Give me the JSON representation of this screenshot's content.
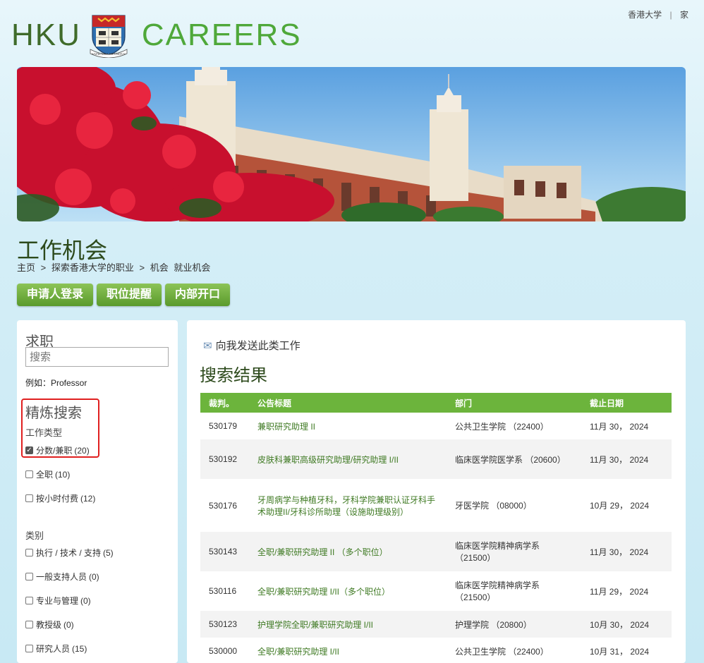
{
  "top_links": {
    "hku": "香港大学",
    "separator": "|",
    "home": "家"
  },
  "logo": {
    "left": "HKU",
    "right": "CAREERS",
    "crest_motto": "SAPIENTIA ET VIRTUS"
  },
  "page": {
    "title": "工作机会",
    "breadcrumb": [
      "主页",
      ">",
      "探索香港大学的职业",
      ">",
      "机会",
      "就业机会"
    ]
  },
  "tabs": [
    "申请人登录",
    "职位提醒",
    "内部开口"
  ],
  "sidebar": {
    "search_title": "求职",
    "search_placeholder": "搜索",
    "example": "例如：Professor",
    "refine_title": "精炼搜索",
    "job_type_title": "工作类型",
    "job_types": [
      {
        "label": "分数/兼职",
        "count": "(20)",
        "checked": true
      },
      {
        "label": "全职",
        "count": "(10)",
        "checked": false
      },
      {
        "label": "按小时付费",
        "count": "(12)",
        "checked": false
      }
    ],
    "category_title": "类别",
    "categories": [
      {
        "label": "执行 / 技术 / 支持",
        "count": "(5)",
        "checked": false
      },
      {
        "label": "一般支持人员",
        "count": "(0)",
        "checked": false
      },
      {
        "label": "专业与管理",
        "count": "(0)",
        "checked": false
      },
      {
        "label": "教授级",
        "count": "(0)",
        "checked": false
      },
      {
        "label": "研究人员",
        "count": "(15)",
        "checked": false
      }
    ]
  },
  "main": {
    "email_link": "向我发送此类工作",
    "results_title": "搜索结果",
    "columns": [
      "裁判。",
      "公告标题",
      "部门",
      "截止日期"
    ],
    "rows": [
      {
        "ref": "530179",
        "title": "兼职研究助理 II",
        "dept": "公共卫生学院 （22400）",
        "deadline": "11月 30， 2024"
      },
      {
        "ref": "530192",
        "title": "皮肤科兼职高级研究助理/研究助理 I/II",
        "dept": "临床医学院医学系 （20600）",
        "deadline": "11月 30， 2024"
      },
      {
        "ref": "530176",
        "title": "牙周病学与种植牙科，牙科学院兼职认证牙科手术助理II/牙科诊所助理（设施助理级别）",
        "dept": "牙医学院 （08000）",
        "deadline": "10月 29， 2024"
      },
      {
        "ref": "530143",
        "title": "全职/兼职研究助理 II （多个职位）",
        "dept": "临床医学院精神病学系 （21500）",
        "deadline": "11月 30， 2024"
      },
      {
        "ref": "530116",
        "title": "全职/兼职研究助理 I/II（多个职位）",
        "dept": "临床医学院精神病学系 （21500）",
        "deadline": "11月 29， 2024"
      },
      {
        "ref": "530123",
        "title": "护理学院全职/兼职研究助理 I/II",
        "dept": "护理学院 （20800）",
        "deadline": "10月 30， 2024"
      },
      {
        "ref": "530000",
        "title": "全职/兼职研究助理 I/II",
        "dept": "公共卫生学院 （22400）",
        "deadline": "10月 31， 2024"
      }
    ]
  },
  "colors": {
    "accent_green": "#6cb43c",
    "title_green": "#2d4a1c",
    "link_green": "#3f7a23",
    "highlight_red": "#e02020"
  }
}
